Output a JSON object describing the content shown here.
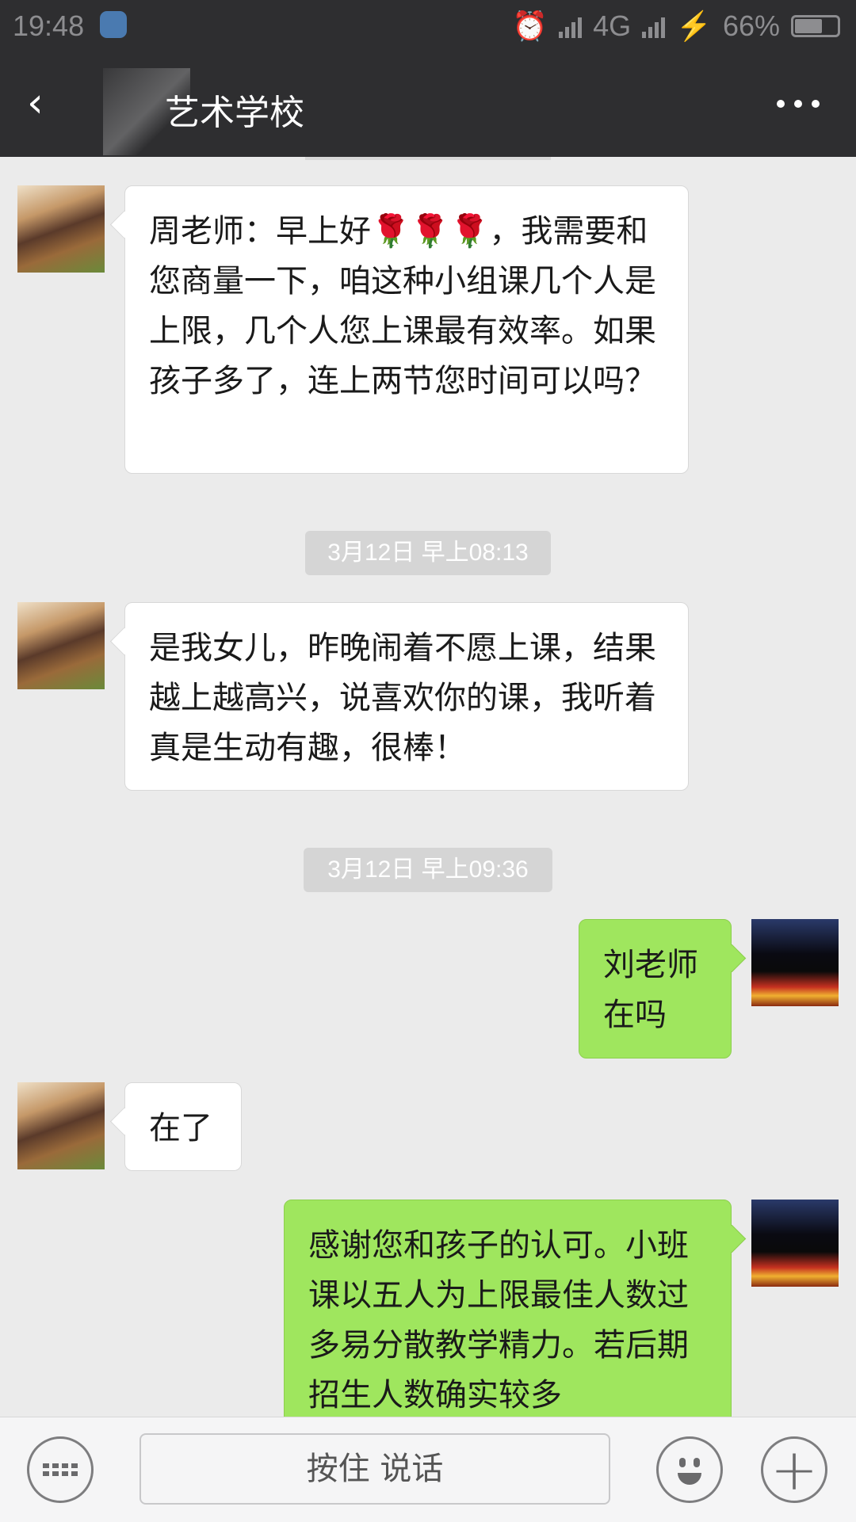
{
  "status_bar": {
    "time": "19:48",
    "network": "4G",
    "battery": "66%"
  },
  "nav": {
    "back_icon": "chevron-left-icon",
    "title": "艺术学校",
    "more_icon": "more-icon"
  },
  "messages": [
    {
      "side": "other",
      "text": "周老师：早上好🌹🌹🌹，我需要和您商量一下，咱这种小组课几个人是上限，几个人您上课最有效率。如果孩子多了，连上两节您时间可以吗？"
    },
    {
      "timestamp": "3月12日 早上08:13"
    },
    {
      "side": "other",
      "text": "是我女儿，昨晚闹着不愿上课，结果越上越高兴，说喜欢你的课，我听着真是生动有趣，很棒！"
    },
    {
      "timestamp": "3月12日 早上09:36"
    },
    {
      "side": "self",
      "text": "刘老师在吗"
    },
    {
      "side": "other",
      "text": "在了"
    },
    {
      "side": "self",
      "text": "感谢您和孩子的认可。小班课以五人为上限最佳人数过多易分散教学精力。若后期招生人数确实较多"
    }
  ],
  "toolbar": {
    "voice_label": "按住 说话",
    "keyboard_icon": "keyboard-icon",
    "emoji_icon": "emoji-icon",
    "plus_icon": "plus-icon"
  }
}
